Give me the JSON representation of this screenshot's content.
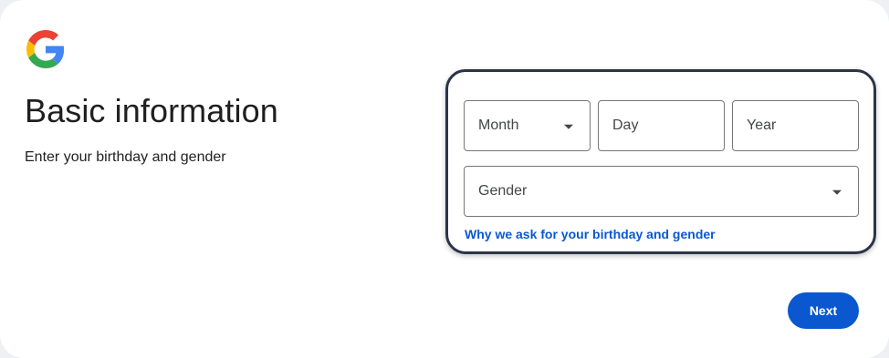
{
  "header": {
    "logo_icon": "google-g-icon",
    "title": "Basic information",
    "subtitle": "Enter your birthday and gender"
  },
  "form": {
    "month": {
      "placeholder": "Month",
      "icon": "dropdown-caret-icon"
    },
    "day": {
      "placeholder": "Day"
    },
    "year": {
      "placeholder": "Year"
    },
    "gender": {
      "placeholder": "Gender",
      "icon": "dropdown-caret-icon"
    },
    "why_link": "Why we ask for your birthday and gender"
  },
  "actions": {
    "next_label": "Next"
  },
  "colors": {
    "primary": "#0b57d0",
    "highlight_border": "#2b3447",
    "field_border": "#747775",
    "text": "#1f1f1f"
  }
}
